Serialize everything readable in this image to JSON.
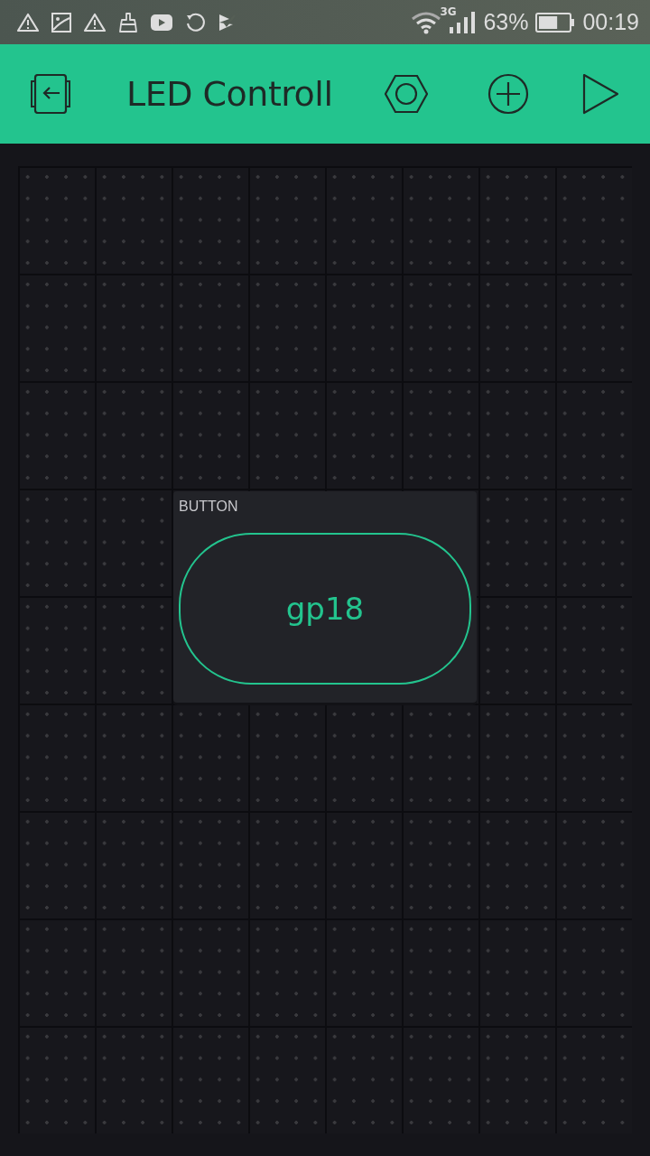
{
  "status_bar": {
    "network": "3G",
    "battery": "63%",
    "time": "00:19"
  },
  "app_bar": {
    "title": "LED Controll"
  },
  "widgets": [
    {
      "kind": "button",
      "label": "BUTTON",
      "text": "gp18"
    }
  ]
}
